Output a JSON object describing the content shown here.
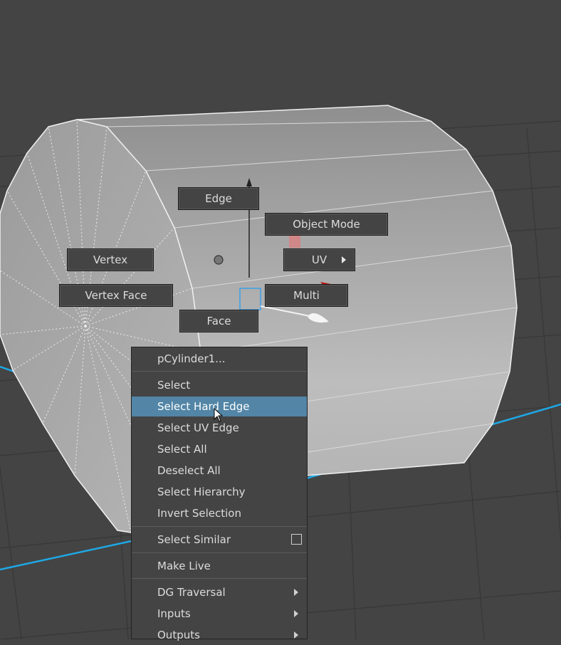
{
  "viewport": {
    "background_color": "#444444",
    "grid_color": "#373737",
    "axis_color": "#1ea8e6",
    "mesh_color": "#a8a8a8",
    "highlight_color": "#5285a6",
    "annotation_color": "#d0191b"
  },
  "marking_menu": {
    "edge": "Edge",
    "object_mode": "Object Mode",
    "vertex": "Vertex",
    "uv": "UV",
    "vertex_face": "Vertex Face",
    "multi": "Multi",
    "face": "Face"
  },
  "context_menu": {
    "header": "pCylinder1...",
    "items": [
      {
        "label": "Select"
      },
      {
        "label": "Select Hard Edge",
        "highlighted": true
      },
      {
        "label": "Select UV Edge"
      },
      {
        "label": "Select All"
      },
      {
        "label": "Deselect All"
      },
      {
        "label": "Select Hierarchy"
      },
      {
        "label": "Invert Selection"
      },
      {
        "label": "Select Similar",
        "has_option_box": true
      },
      {
        "label": "Make Live"
      },
      {
        "label": "DG Traversal",
        "has_submenu": true
      },
      {
        "label": "Inputs",
        "has_submenu": true
      },
      {
        "label": "Outputs",
        "has_submenu": true
      }
    ]
  }
}
